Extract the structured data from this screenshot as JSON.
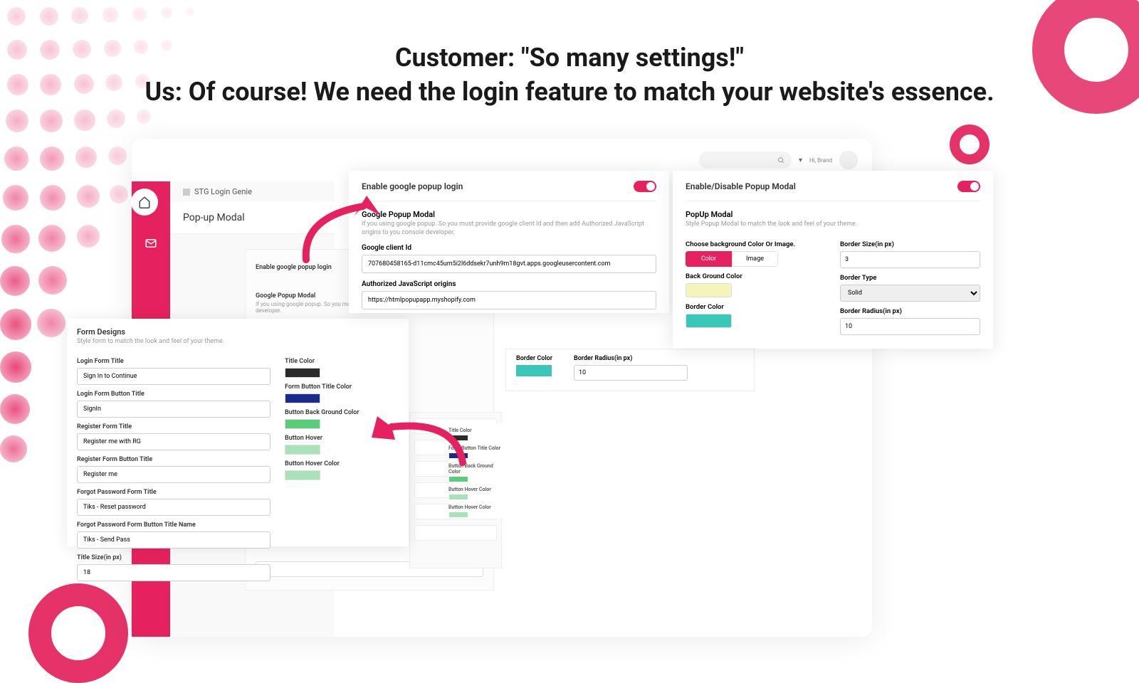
{
  "headline": "Customer: \"So many settings!\"",
  "subhead": "Us: Of course! We need the login feature to match your website's essence.",
  "topbar": {
    "hi": "Hi, Brand"
  },
  "subsidebar": {
    "app": "STG Login Genie",
    "section": "Pop-up Modal"
  },
  "bg_panel": {
    "enable_label": "Enable google popup login",
    "h": "Google Popup Modal",
    "desc": "If you using google popup. So you must provide google client Id from google console developer.",
    "client_lbl": "Google client Id",
    "title_size_lbl": "Title Size(in px)",
    "title_size_val": "18"
  },
  "form_designs": {
    "h": "Form Designs",
    "desc": "Style form to match the look and feel of your theme.",
    "login_form_title_lbl": "Login Form Title",
    "login_form_title_val": "Sign In to Continue",
    "login_btn_lbl": "Login Form Button Title",
    "login_btn_val": "SignIn",
    "register_title_lbl": "Register Form Title",
    "register_title_val": "Register me with RG",
    "register_btn_lbl": "Register Form Button Title",
    "register_btn_val": "Register me",
    "forgot_title_lbl": "Forgot Password Form Title",
    "forgot_title_val": "Tiks - Reset password",
    "forgot_btn_lbl": "Forgot Password Form Button Title Name",
    "forgot_btn_val": "Tiks - Send Pass",
    "size_lbl": "Title Size(in px)",
    "size_val": "18",
    "title_color_lbl": "Title Color",
    "form_btn_title_color_lbl": "Form Button Title Color",
    "btn_bg_lbl": "Button Back Ground Color",
    "btn_hover_lbl": "Button Hover",
    "btn_hover_color_lbl": "Button Hover Color",
    "colors": {
      "title": "#2b2b2b",
      "form_btn_title": "#1a2b8c",
      "btn_bg": "#5bcc7a",
      "btn_hover": "#a8e2b8",
      "btn_hover_color": "#a8e2b8"
    }
  },
  "mini": {
    "title_color": "Title Color",
    "form_btn_title_color": "Form Button Title Color",
    "btn_bg": "Button Back Ground Color",
    "btn_hover": "Button Hover Color",
    "btn_hover_color": "Button Hover Color",
    "colors": {
      "a": "#2b2b2b",
      "b": "#1a2b8c",
      "c": "#5bcc7a",
      "d": "#a8e2b8",
      "e": "#a8e2b8"
    }
  },
  "google": {
    "header": "Enable google popup login",
    "h": "Google Popup Modal",
    "desc": "If you using google popup. So you must provide google client Id and then add Authorized JavaScript origins to you console developer.",
    "client_lbl": "Google client Id",
    "client_val": "707680458165-d11cmc45um5i2l6ddsekr7unh9m18gvt.apps.googleusercontent.com",
    "origins_lbl": "Authorized JavaScript origins",
    "origins_val": "https://htmlpopupapp.myshopify.com"
  },
  "popup": {
    "header": "Enable/Disable Popup Modal",
    "h": "PopUp Modal",
    "desc": "Style Popup Modal to match the look and feel of your theme.",
    "bg_choice_lbl": "Choose background Color Or Image.",
    "pill_color": "Color",
    "pill_image": "Image",
    "bg_color_lbl": "Back Ground Color",
    "border_color_lbl": "Border Color",
    "border_size_lbl": "Border Size(in px)",
    "border_size_val": "3",
    "border_type_lbl": "Border Type",
    "border_type_val": "Solid",
    "border_radius_lbl": "Border Radius(in px)",
    "border_radius_val": "10",
    "colors": {
      "bg": "#f5f5bb",
      "border": "#3ac7b9"
    }
  },
  "bottom": {
    "border_color_lbl": "Border Color",
    "border_radius_lbl": "Border Radius(in px)",
    "border_radius_val": "10",
    "color": "#3ac7b9"
  }
}
